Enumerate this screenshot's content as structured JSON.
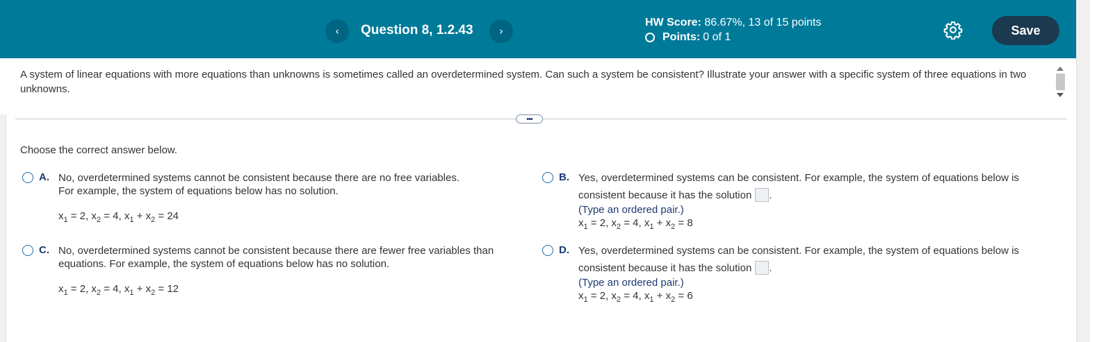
{
  "header": {
    "question_title": "Question 8, 1.2.43",
    "prev_icon": "‹",
    "next_icon": "›",
    "hw_score_label": "HW Score:",
    "hw_score_value": "86.67%, 13 of 15 points",
    "points_label": "Points:",
    "points_value": "0 of 1",
    "save_label": "Save",
    "settings_icon": "gear-icon",
    "accent_color": "#007a99"
  },
  "question": {
    "text": "A system of linear equations with more equations than unknowns is sometimes called an overdetermined system. Can such a system be consistent? Illustrate your answer with a specific system of three equations in two unknowns.",
    "prompt": "Choose the correct answer below.",
    "expand_label": "•••"
  },
  "options": {
    "a": {
      "letter": "A.",
      "line1": "No, overdetermined systems cannot be consistent because there are no free variables.",
      "line2": "For example, the system of equations below has no solution.",
      "eq": {
        "v1": "2",
        "v2": "4",
        "v3": "24"
      }
    },
    "b": {
      "letter": "B.",
      "line1": "Yes, overdetermined systems can be consistent. For example, the system of equations below is",
      "line2": "consistent because it has the solution",
      "hint": "(Type an ordered pair.)",
      "eq": {
        "v1": "2",
        "v2": "4",
        "v3": "8"
      }
    },
    "c": {
      "letter": "C.",
      "line1": "No, overdetermined systems cannot be consistent because there are fewer free variables than",
      "line2": "equations. For example, the system of equations below has no solution.",
      "eq": {
        "v1": "2",
        "v2": "4",
        "v3": "12"
      }
    },
    "d": {
      "letter": "D.",
      "line1": "Yes, overdetermined systems can be consistent. For example, the system of equations below is",
      "line2": "consistent because it has the solution",
      "hint": "(Type an ordered pair.)",
      "eq": {
        "v1": "2",
        "v2": "4",
        "v3": "6"
      }
    }
  }
}
